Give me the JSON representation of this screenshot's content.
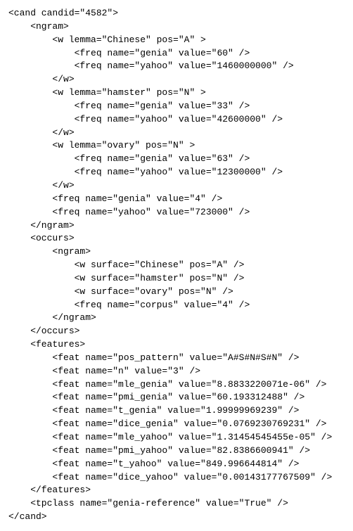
{
  "lines": {
    "l0": "<cand candid=\"4582\">",
    "l1": "    <ngram>",
    "l2": "        <w lemma=\"Chinese\" pos=\"A\" >",
    "l3": "            <freq name=\"genia\" value=\"60\" />",
    "l4": "            <freq name=\"yahoo\" value=\"1460000000\" />",
    "l5": "        </w>",
    "l6": "        <w lemma=\"hamster\" pos=\"N\" >",
    "l7": "            <freq name=\"genia\" value=\"33\" />",
    "l8": "            <freq name=\"yahoo\" value=\"42600000\" />",
    "l9": "        </w>",
    "l10": "        <w lemma=\"ovary\" pos=\"N\" >",
    "l11": "            <freq name=\"genia\" value=\"63\" />",
    "l12": "            <freq name=\"yahoo\" value=\"12300000\" />",
    "l13": "        </w>",
    "l14": "        <freq name=\"genia\" value=\"4\" />",
    "l15": "        <freq name=\"yahoo\" value=\"723000\" />",
    "l16": "    </ngram>",
    "l17": "    <occurs>",
    "l18": "        <ngram>",
    "l19": "            <w surface=\"Chinese\" pos=\"A\" />",
    "l20": "            <w surface=\"hamster\" pos=\"N\" />",
    "l21": "            <w surface=\"ovary\" pos=\"N\" />",
    "l22": "            <freq name=\"corpus\" value=\"4\" />",
    "l23": "        </ngram>",
    "l24": "    </occurs>",
    "l25": "    <features>",
    "l26": "        <feat name=\"pos_pattern\" value=\"A#S#N#S#N\" />",
    "l27": "        <feat name=\"n\" value=\"3\" />",
    "l28": "        <feat name=\"mle_genia\" value=\"8.8833220071e-06\" />",
    "l29": "        <feat name=\"pmi_genia\" value=\"60.193312488\" />",
    "l30": "        <feat name=\"t_genia\" value=\"1.99999969239\" />",
    "l31": "        <feat name=\"dice_genia\" value=\"0.0769230769231\" />",
    "l32": "        <feat name=\"mle_yahoo\" value=\"1.31454545455e-05\" />",
    "l33": "        <feat name=\"pmi_yahoo\" value=\"82.8386600941\" />",
    "l34": "        <feat name=\"t_yahoo\" value=\"849.996644814\" />",
    "l35": "        <feat name=\"dice_yahoo\" value=\"0.00143177767509\" />",
    "l36": "    </features>",
    "l37": "    <tpclass name=\"genia-reference\" value=\"True\" />",
    "l38": "</cand>"
  }
}
